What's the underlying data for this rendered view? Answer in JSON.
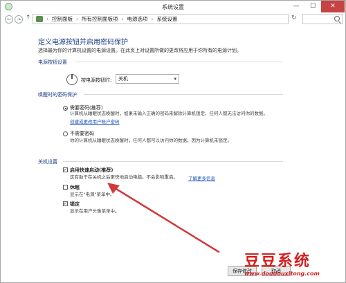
{
  "window": {
    "title": "系统设置",
    "min": "—",
    "max": "☐",
    "close": "✕"
  },
  "address": {
    "crumbs": [
      "控制面板",
      "所有控制面板项",
      "电源选项",
      "系统设置"
    ],
    "sep": "›"
  },
  "content": {
    "heading": "定义电源按钮并启用密码保护",
    "intro": "选择最为你的计算机设置的电源设置。在此页上对设置所做的更改将应用于你所有的电源计划。",
    "power_section": {
      "label": "电源按钮设置",
      "row_label": "按电源按钮时:",
      "select_value": "关机"
    },
    "wake_section": {
      "label": "唤醒时的密码保护",
      "opt1_label": "需要密码(推荐)",
      "opt1_desc": "计算机从睡眠状态唤醒时，如果未输入正确的密码来解除计算机锁定，任何人都无法访问你的数据。",
      "opt1_link": "创建或更改用户帐户密码",
      "opt2_label": "不需要密码",
      "opt2_desc": "你的计算机从睡眠状态唤醒时，任何人都可以访问你的数据，因为计算机未锁定。"
    },
    "shutdown_section": {
      "label": "关机设置",
      "fast_label": "启用快速启动(推荐)",
      "fast_desc": "这有助于在关机之后更快地启动电脑。不会影响重启。",
      "fast_link": "了解更多信息",
      "sleep_label": "休眠",
      "sleep_desc": "显示在\"电源\"菜单中。",
      "lock_label": "锁定",
      "lock_desc": "显示在用户头像菜单中。"
    }
  },
  "footer": {
    "save": "保存修改",
    "cancel": "取消"
  },
  "watermark": {
    "cn": "豆豆系统",
    "url": "www.doudouxitong.com"
  },
  "colors": {
    "heading": "#1e3f8a",
    "link": "#1a4fbf",
    "close_btn": "#c74242",
    "arrow": "#d03a3a"
  }
}
